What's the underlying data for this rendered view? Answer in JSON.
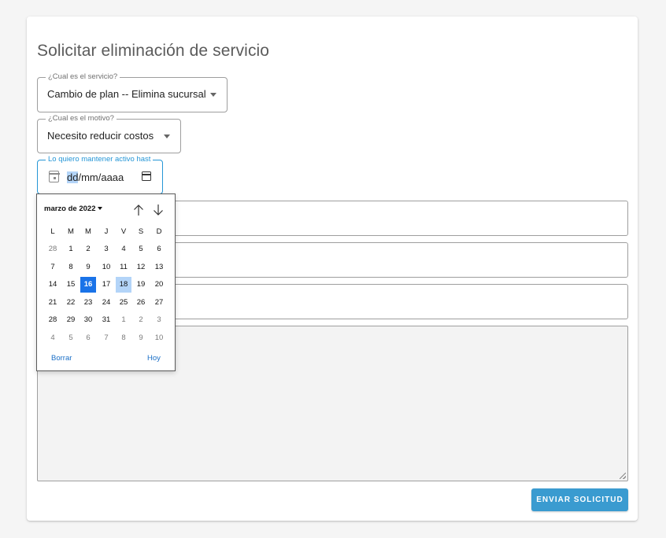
{
  "form": {
    "title": "Solicitar eliminación de servicio",
    "service_field": {
      "legend": "¿Cual es el servicio?",
      "value": "Cambio de plan -- Elimina sucursal"
    },
    "reason_field": {
      "legend": "¿Cual es el motivo?",
      "value": "Necesito reducir costos"
    },
    "date_field": {
      "legend": "Lo quiero mantener activo hast",
      "day_part": "dd",
      "rest_part": "/mm/aaaa"
    },
    "submit_label": "ENVIAR SOLICITUD"
  },
  "datepicker": {
    "month_label": "marzo de 2022",
    "weekdays": [
      "L",
      "M",
      "M",
      "J",
      "V",
      "S",
      "D"
    ],
    "weeks": [
      [
        "28",
        "1",
        "2",
        "3",
        "4",
        "5",
        "6"
      ],
      [
        "7",
        "8",
        "9",
        "10",
        "11",
        "12",
        "13"
      ],
      [
        "14",
        "15",
        "16",
        "17",
        "18",
        "19",
        "20"
      ],
      [
        "21",
        "22",
        "23",
        "24",
        "25",
        "26",
        "27"
      ],
      [
        "28",
        "29",
        "30",
        "31",
        "1",
        "2",
        "3"
      ],
      [
        "4",
        "5",
        "6",
        "7",
        "8",
        "9",
        "10"
      ]
    ],
    "today": "16",
    "selected": "18",
    "clear_label": "Borrar",
    "today_label": "Hoy"
  },
  "colors": {
    "accent": "#2596d6",
    "button": "#3a9bd0",
    "today_bg": "#1a73e8",
    "selected_bg": "#b3d4f8"
  }
}
